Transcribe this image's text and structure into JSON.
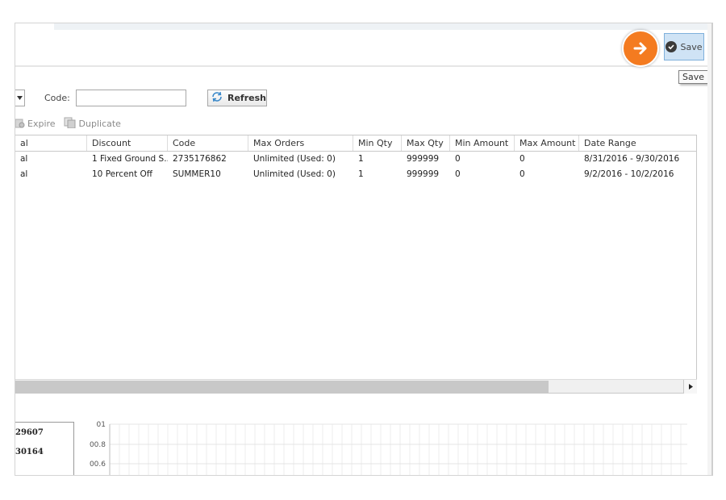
{
  "toolbar": {
    "save_label": "Save",
    "save_tooltip": "Save"
  },
  "filter": {
    "code_label": "Code:",
    "code_value": "",
    "refresh_label": "Refresh"
  },
  "actions": {
    "expire_label": "Expire",
    "duplicate_label": "Duplicate"
  },
  "grid": {
    "headers": [
      "al",
      "Discount",
      "Code",
      "Max Orders",
      "Min Qty",
      "Max Qty",
      "Min Amount",
      "Max Amount",
      "Date Range"
    ],
    "rows": [
      [
        "al",
        "1 Fixed Ground S...",
        "2735176862",
        "Unlimited (Used: 0)",
        "1",
        "999999",
        "0",
        "0",
        "8/31/2016 - 9/30/2016"
      ],
      [
        "al",
        "10 Percent Off",
        "SUMMER10",
        "Unlimited (Used: 0)",
        "1",
        "999999",
        "0",
        "0",
        "9/2/2016 - 10/2/2016"
      ]
    ]
  },
  "stats": {
    "value_1": "29607",
    "value_2": "30164"
  },
  "chart_data": {
    "type": "line",
    "y_tick_labels": [
      "01",
      "00.8",
      "00.6"
    ],
    "grid": true,
    "series": []
  },
  "colors": {
    "accent": "#f47b20",
    "save_bg": "#cfe3f5",
    "scroll_thumb": "#c8c8c8"
  },
  "icons": {
    "next": "arrow-right-icon",
    "save": "check-circle-icon",
    "refresh": "refresh-icon",
    "expire": "expire-icon",
    "duplicate": "duplicate-icon",
    "dropdown": "chevron-down-icon",
    "scroll": "chevron-right-icon"
  }
}
